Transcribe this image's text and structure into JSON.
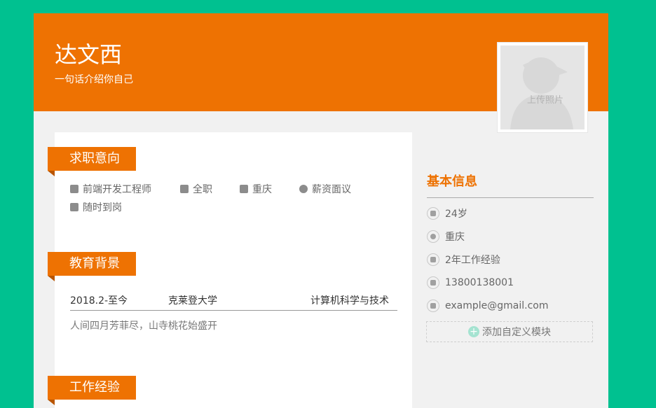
{
  "header": {
    "name": "达文西",
    "slogan": "一句话介绍你自己",
    "photo_label": "上传照片"
  },
  "intent": {
    "title": "求职意向",
    "items": [
      {
        "icon": "briefcase-icon",
        "text": "前端开发工程师"
      },
      {
        "icon": "id-card-icon",
        "text": "全职"
      },
      {
        "icon": "city-icon",
        "text": "重庆"
      },
      {
        "icon": "money-icon",
        "text": "薪资面议"
      },
      {
        "icon": "calendar-icon",
        "text": "随时到岗"
      }
    ]
  },
  "education": {
    "title": "教育背景",
    "period": "2018.2-至今",
    "school": "克莱登大学",
    "major": "计算机科学与技术",
    "description": "人间四月芳菲尽，山寺桃花始盛开"
  },
  "work": {
    "title": "工作经验"
  },
  "basic_info": {
    "title": "基本信息",
    "items": [
      {
        "icon": "calendar-icon",
        "text": "24岁"
      },
      {
        "icon": "location-icon",
        "text": "重庆"
      },
      {
        "icon": "work-experience-icon",
        "text": "2年工作经验"
      },
      {
        "icon": "phone-icon",
        "text": "13800138001"
      },
      {
        "icon": "mail-icon",
        "text": "example@gmail.com"
      }
    ],
    "add_label": "添加自定义模块"
  },
  "colors": {
    "accent": "#ee7202",
    "background": "#00c190",
    "panel": "#f1f1f1"
  }
}
